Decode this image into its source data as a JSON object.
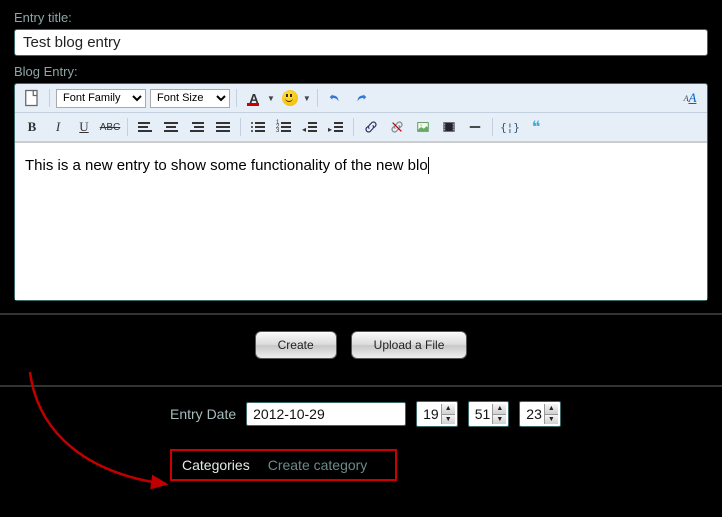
{
  "labels": {
    "entry_title": "Entry title:",
    "blog_entry": "Blog Entry:",
    "entry_date": "Entry Date",
    "categories": "Categories",
    "create_category": "Create category"
  },
  "fields": {
    "title_value": "Test blog entry",
    "body_text": "This is a new entry to show some functionality of the new blo",
    "date_value": "2012-10-29",
    "hour": "19",
    "minute": "51",
    "second": "23"
  },
  "buttons": {
    "create": "Create",
    "upload": "Upload a File"
  },
  "toolbar": {
    "font_family_placeholder": "Font Family",
    "font_size_placeholder": "Font Size"
  },
  "annotation": {
    "highlight_color": "#c00000"
  }
}
